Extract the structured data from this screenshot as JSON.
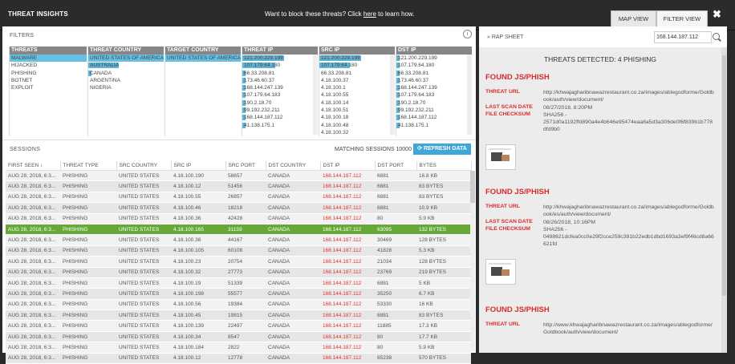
{
  "header": {
    "title": "THREAT INSIGHTS",
    "promo_prefix": "Want to block these threats? Click ",
    "promo_link": "here",
    "promo_suffix": " to learn how.",
    "tab_map": "MAP VIEW",
    "tab_filter": "FILTER VIEW",
    "close": "✖"
  },
  "filters": {
    "label": "FILTERS",
    "info": "i",
    "threats": {
      "header": "THREATS",
      "items": [
        "MALWARE",
        "HIJACKED",
        "PHISHING",
        "BOTNET",
        "EXPLOIT"
      ]
    },
    "threat_country": {
      "header": "THREAT COUNTRY",
      "items": [
        "UNITED STATES OF AMERICA",
        "AUSTRALIA",
        "CANADA",
        "ARGENTINA",
        "NIGERIA"
      ]
    },
    "target_country": {
      "header": "TARGET COUNTRY",
      "items": [
        "UNITED STATES OF AMERICA"
      ]
    },
    "threat_ip": {
      "header": "THREAT IP",
      "items": [
        "121.200.229.199",
        "107.179.64.180",
        "66.33.208.81",
        "173.46.60.37",
        "168.144.247.139",
        "107.179.64.183",
        "190.2.18.70",
        "99.192.232.211",
        "168.144.187.112",
        "41.138.175.1"
      ]
    },
    "src_ip": {
      "header": "SRC IP",
      "items": [
        "121.200.229.199",
        "107.179.64.180",
        "66.33.208.81",
        "4.18.100.37",
        "4.18.100.1",
        "4.18.100.55",
        "4.18.100.14",
        "4.18.100.51",
        "4.18.100.18",
        "4.18.100.48",
        "4.18.100.32"
      ]
    },
    "dst_ip": {
      "header": "DST IP",
      "items": [
        "121.200.229.199",
        "107.179.64.180",
        "66.33.208.81",
        "173.46.60.37",
        "168.144.247.139",
        "107.179.64.183",
        "190.2.18.70",
        "99.192.232.211",
        "168.144.187.112",
        "41.138.175.1"
      ]
    }
  },
  "sessions": {
    "label": "SESSIONS",
    "matching": "MATCHING SESSIONS 10000",
    "refresh": "REFRESH DATA",
    "columns": [
      "FIRST SEEN ↓",
      "THREAT TYPE",
      "SRC COUNTRY",
      "SRC IP",
      "SRC PORT",
      "DST COUNTRY",
      "DST IP",
      "DST PORT",
      "BYTES"
    ],
    "rows": [
      [
        "AUG 28, 2018, 6:3...",
        "PHISHING",
        "UNITED STATES",
        "4.18.100.190",
        "58657",
        "CANADA",
        "168.144.187.112",
        "6881",
        "16.8 KB"
      ],
      [
        "AUG 28, 2018, 6:3...",
        "PHISHING",
        "UNITED STATES",
        "4.18.100.12",
        "51456",
        "CANADA",
        "168.144.187.112",
        "6881",
        "83 BYTES"
      ],
      [
        "AUG 28, 2018, 6:3...",
        "PHISHING",
        "UNITED STATES",
        "4.18.100.55",
        "26857",
        "CANADA",
        "168.144.187.112",
        "6881",
        "83 BYTES"
      ],
      [
        "AUG 28, 2018, 6:3...",
        "PHISHING",
        "UNITED STATES",
        "4.18.100.46",
        "18218",
        "CANADA",
        "168.144.187.112",
        "6881",
        "10.9 KB"
      ],
      [
        "AUG 28, 2018, 6:3...",
        "PHISHING",
        "UNITED STATES",
        "4.18.100.36",
        "42428",
        "CANADA",
        "168.144.187.112",
        "80",
        "5.9 KB"
      ],
      [
        "AUG 28, 2018, 6:3...",
        "PHISHING",
        "UNITED STATES",
        "4.18.100.165",
        "31159",
        "CANADA",
        "168.144.187.112",
        "63095",
        "132 BYTES"
      ],
      [
        "AUG 28, 2018, 6:3...",
        "PHISHING",
        "UNITED STATES",
        "4.18.100.38",
        "44167",
        "CANADA",
        "168.144.187.112",
        "30469",
        "128 BYTES"
      ],
      [
        "AUG 28, 2018, 6:3...",
        "PHISHING",
        "UNITED STATES",
        "4.18.100.105",
        "60108",
        "CANADA",
        "168.144.187.112",
        "41828",
        "5.3 KB"
      ],
      [
        "AUG 28, 2018, 6:3...",
        "PHISHING",
        "UNITED STATES",
        "4.18.100.23",
        "20754",
        "CANADA",
        "168.144.187.112",
        "21034",
        "128 BYTES"
      ],
      [
        "AUG 28, 2018, 6:3...",
        "PHISHING",
        "UNITED STATES",
        "4.18.100.32",
        "27773",
        "CANADA",
        "168.144.187.112",
        "23769",
        "219 BYTES"
      ],
      [
        "AUG 28, 2018, 6:3...",
        "PHISHING",
        "UNITED STATES",
        "4.18.100.19",
        "51339",
        "CANADA",
        "168.144.187.112",
        "6881",
        "5 KB"
      ],
      [
        "AUG 28, 2018, 6:3...",
        "PHISHING",
        "UNITED STATES",
        "4.18.100.198",
        "55577",
        "CANADA",
        "168.144.187.112",
        "35250",
        "6.7 KB"
      ],
      [
        "AUG 28, 2018, 6:3...",
        "PHISHING",
        "UNITED STATES",
        "4.18.100.56",
        "19384",
        "CANADA",
        "168.144.187.112",
        "53330",
        "16 KB"
      ],
      [
        "AUG 28, 2018, 6:3...",
        "PHISHING",
        "UNITED STATES",
        "4.18.100.45",
        "19815",
        "CANADA",
        "168.144.187.112",
        "6881",
        "83 BYTES"
      ],
      [
        "AUG 28, 2018, 6:3...",
        "PHISHING",
        "UNITED STATES",
        "4.18.100.139",
        "22497",
        "CANADA",
        "168.144.187.112",
        "11885",
        "17.3 KB"
      ],
      [
        "AUG 28, 2018, 6:3...",
        "PHISHING",
        "UNITED STATES",
        "4.18.100.34",
        "8547",
        "CANADA",
        "168.144.187.112",
        "80",
        "17.7 KB"
      ],
      [
        "AUG 28, 2018, 6:3...",
        "PHISHING",
        "UNITED STATES",
        "4.18.100.184",
        "2822",
        "CANADA",
        "168.144.187.112",
        "80",
        "5.9 KB"
      ],
      [
        "AUG 28, 2018, 6:3...",
        "PHISHING",
        "UNITED STATES",
        "4.18.100.12",
        "12778",
        "CANADA",
        "168.144.187.112",
        "65238",
        "570 BYTES"
      ]
    ],
    "highlight_index": 5
  },
  "rap_sheet": {
    "label": "» RAP SHEET",
    "search_value": "168.144.187.112",
    "detected": "THREATS DETECTED: 4 PHISHING",
    "url_label": "THREAT URL",
    "scan_label": "LAST SCAN DATE",
    "checksum_label": "FILE CHECKSUM",
    "cards": [
      {
        "title": "FOUND JS/PHISH",
        "url": "http://khwajagharibnawazrestaurant.co.za/images/ablegodforme/Goldbook/auth/view/document/",
        "scan": "08/27/2018, 8:20PM",
        "checksum": "SHA256 - 2571d0a1192ffd890a4e4b646e95474eaa8a5d3a306de0f6f839b1b778dfd9b0"
      },
      {
        "title": "FOUND JS/PHISH",
        "url": "http://khwajagharibnawazrestaurant.co.za/images/ablegodforme/Goldbook/es/auth/view/document/",
        "scan": "08/26/2018, 10:16PM",
        "checksum": "SHA256 - 0498621dcfea0cc0e29f2cce259c391b22edb1dbd1693a3ef9f46cd8a66621fd"
      },
      {
        "title": "FOUND JS/PHISH",
        "url": "http://www.khwajagharibnawazrestaurant.co.za/images/ablegodforme/Goldbook/auth/view/document/",
        "scan": "",
        "checksum": ""
      }
    ]
  },
  "colors": {
    "accent": "#3ea6d8",
    "danger": "#d92b2b",
    "highlight_row": "#67a839",
    "filter_bar": "#5fb4d8"
  }
}
